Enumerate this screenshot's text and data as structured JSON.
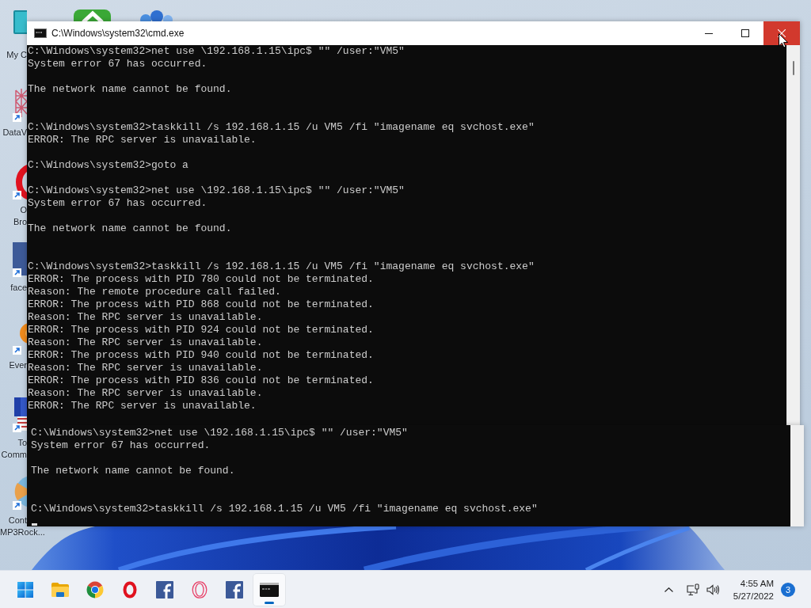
{
  "desktop": {
    "columns": [
      {
        "icons": [
          {
            "kind": "monitor",
            "shortcut": false,
            "label_lines": [
              "My C"
            ]
          },
          {
            "kind": "lattice",
            "shortcut": true,
            "label_lines": [
              "DataV"
            ]
          },
          {
            "kind": "ring",
            "shortcut": true,
            "label_lines": [
              "O",
              "Bro"
            ]
          },
          {
            "kind": "tile",
            "shortcut": true,
            "label_lines": [
              "face"
            ]
          },
          {
            "kind": "blob",
            "shortcut": true,
            "label_lines": [
              "Ever"
            ]
          },
          {
            "kind": "panels",
            "shortcut": true,
            "label_lines": [
              "To",
              "Comm"
            ]
          },
          {
            "kind": "disc",
            "shortcut": true,
            "label_lines": [
              "Cont",
              "MP3Rock..."
            ]
          }
        ]
      },
      {
        "icons": [
          {
            "kind": "green",
            "shortcut": false
          }
        ]
      },
      {
        "icons": [
          {
            "kind": "bubbles",
            "shortcut": false
          }
        ]
      }
    ]
  },
  "window": {
    "title": "C:\\Windows\\system32\\cmd.exe",
    "controls": [
      {
        "kind": "minimize",
        "hovered": false
      },
      {
        "kind": "maximize",
        "hovered": false
      },
      {
        "kind": "close",
        "hovered": true
      }
    ],
    "lines": [
      {
        "kind": "text",
        "text": "C:\\Windows\\system32>net use \\192.168.1.15\\ipc$ \"\" /user:\"VM5\""
      },
      {
        "kind": "text",
        "text": "System error 67 has occurred."
      },
      {
        "kind": "blank"
      },
      {
        "kind": "text",
        "text": "The network name cannot be found."
      },
      {
        "kind": "blank"
      },
      {
        "kind": "blank"
      },
      {
        "kind": "text",
        "text": "C:\\Windows\\system32>taskkill /s 192.168.1.15 /u VM5 /fi \"imagename eq svchost.exe\""
      },
      {
        "kind": "text",
        "text": "ERROR: The RPC server is unavailable."
      },
      {
        "kind": "blank"
      },
      {
        "kind": "text",
        "text": "C:\\Windows\\system32>goto a"
      },
      {
        "kind": "blank"
      },
      {
        "kind": "text",
        "text": "C:\\Windows\\system32>net use \\192.168.1.15\\ipc$ \"\" /user:\"VM5\""
      },
      {
        "kind": "text",
        "text": "System error 67 has occurred."
      },
      {
        "kind": "blank"
      },
      {
        "kind": "text",
        "text": "The network name cannot be found."
      },
      {
        "kind": "blank"
      },
      {
        "kind": "blank"
      },
      {
        "kind": "text",
        "text": "C:\\Windows\\system32>taskkill /s 192.168.1.15 /u VM5 /fi \"imagename eq svchost.exe\""
      },
      {
        "kind": "text",
        "text": "ERROR: The process with PID 780 could not be terminated."
      },
      {
        "kind": "text",
        "text": "Reason: The remote procedure call failed."
      },
      {
        "kind": "text",
        "text": "ERROR: The process with PID 868 could not be terminated."
      },
      {
        "kind": "text",
        "text": "Reason: The RPC server is unavailable."
      },
      {
        "kind": "text",
        "text": "ERROR: The process with PID 924 could not be terminated."
      },
      {
        "kind": "text",
        "text": "Reason: The RPC server is unavailable."
      },
      {
        "kind": "text",
        "text": "ERROR: The process with PID 940 could not be terminated."
      },
      {
        "kind": "text",
        "text": "Reason: The RPC server is unavailable."
      },
      {
        "kind": "text",
        "text": "ERROR: The process with PID 836 could not be terminated."
      },
      {
        "kind": "text",
        "text": "Reason: The RPC server is unavailable."
      },
      {
        "kind": "text",
        "text": "ERROR: The RPC server is unavailable."
      }
    ]
  },
  "lower_window": {
    "lines": [
      {
        "kind": "text",
        "text": "C:\\Windows\\system32>net use \\192.168.1.15\\ipc$ \"\" /user:\"VM5\""
      },
      {
        "kind": "text",
        "text": "System error 67 has occurred."
      },
      {
        "kind": "blank"
      },
      {
        "kind": "text",
        "text": "The network name cannot be found."
      },
      {
        "kind": "blank"
      },
      {
        "kind": "blank"
      },
      {
        "kind": "text",
        "text": "C:\\Windows\\system32>taskkill /s 192.168.1.15 /u VM5 /fi \"imagename eq svchost.exe\""
      }
    ],
    "cursor": true
  },
  "taskbar": {
    "items": [
      {
        "kind": "start",
        "active": false
      },
      {
        "kind": "folder",
        "active": false
      },
      {
        "kind": "wheel",
        "active": false
      },
      {
        "kind": "ring",
        "active": false
      },
      {
        "kind": "fbox",
        "active": false
      },
      {
        "kind": "thinring",
        "active": false
      },
      {
        "kind": "fbox",
        "active": false
      },
      {
        "kind": "console",
        "active": true
      }
    ],
    "tray": {
      "time": "4:55 AM",
      "date": "5/27/2022",
      "notifications": "3"
    }
  }
}
